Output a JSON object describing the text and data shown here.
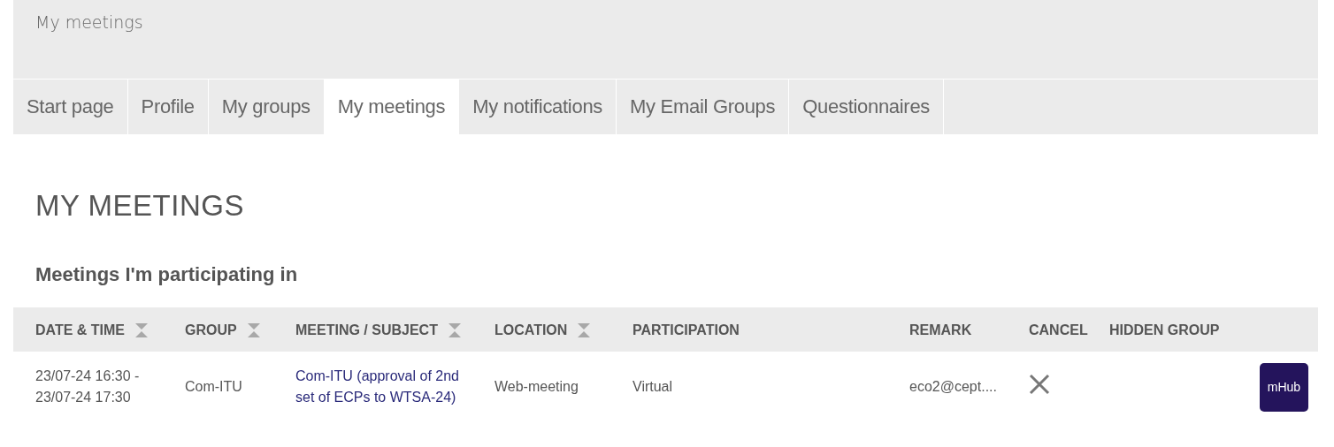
{
  "header": {
    "title": "My meetings"
  },
  "tabs": [
    {
      "label": "Start page",
      "selected": false
    },
    {
      "label": "Profile",
      "selected": false
    },
    {
      "label": "My groups",
      "selected": false
    },
    {
      "label": "My meetings",
      "selected": true
    },
    {
      "label": "My notifications",
      "selected": false
    },
    {
      "label": "My Email Groups",
      "selected": false
    },
    {
      "label": "Questionnaires",
      "selected": false
    }
  ],
  "page_title": "MY MEETINGS",
  "section_title": "Meetings I'm participating in",
  "table": {
    "columns": [
      {
        "label": "DATE & TIME",
        "sortable": true
      },
      {
        "label": "GROUP",
        "sortable": true
      },
      {
        "label": "MEETING / SUBJECT",
        "sortable": true
      },
      {
        "label": "LOCATION",
        "sortable": true
      },
      {
        "label": "PARTICIPATION",
        "sortable": false
      },
      {
        "label": "REMARK",
        "sortable": false
      },
      {
        "label": "CANCEL",
        "sortable": false
      },
      {
        "label": "HIDDEN GROUP",
        "sortable": false
      }
    ],
    "rows": [
      {
        "date_time": [
          "23/07-24 16:30 -",
          "23/07-24 17:30"
        ],
        "group": "Com-ITU",
        "meeting": "Com-ITU (approval of 2nd set of ECPs to WTSA-24)",
        "location": "Web-meeting",
        "participation": "Virtual",
        "remark": "eco2@cept....",
        "cancelable": true,
        "app_button": "mHub"
      }
    ]
  }
}
